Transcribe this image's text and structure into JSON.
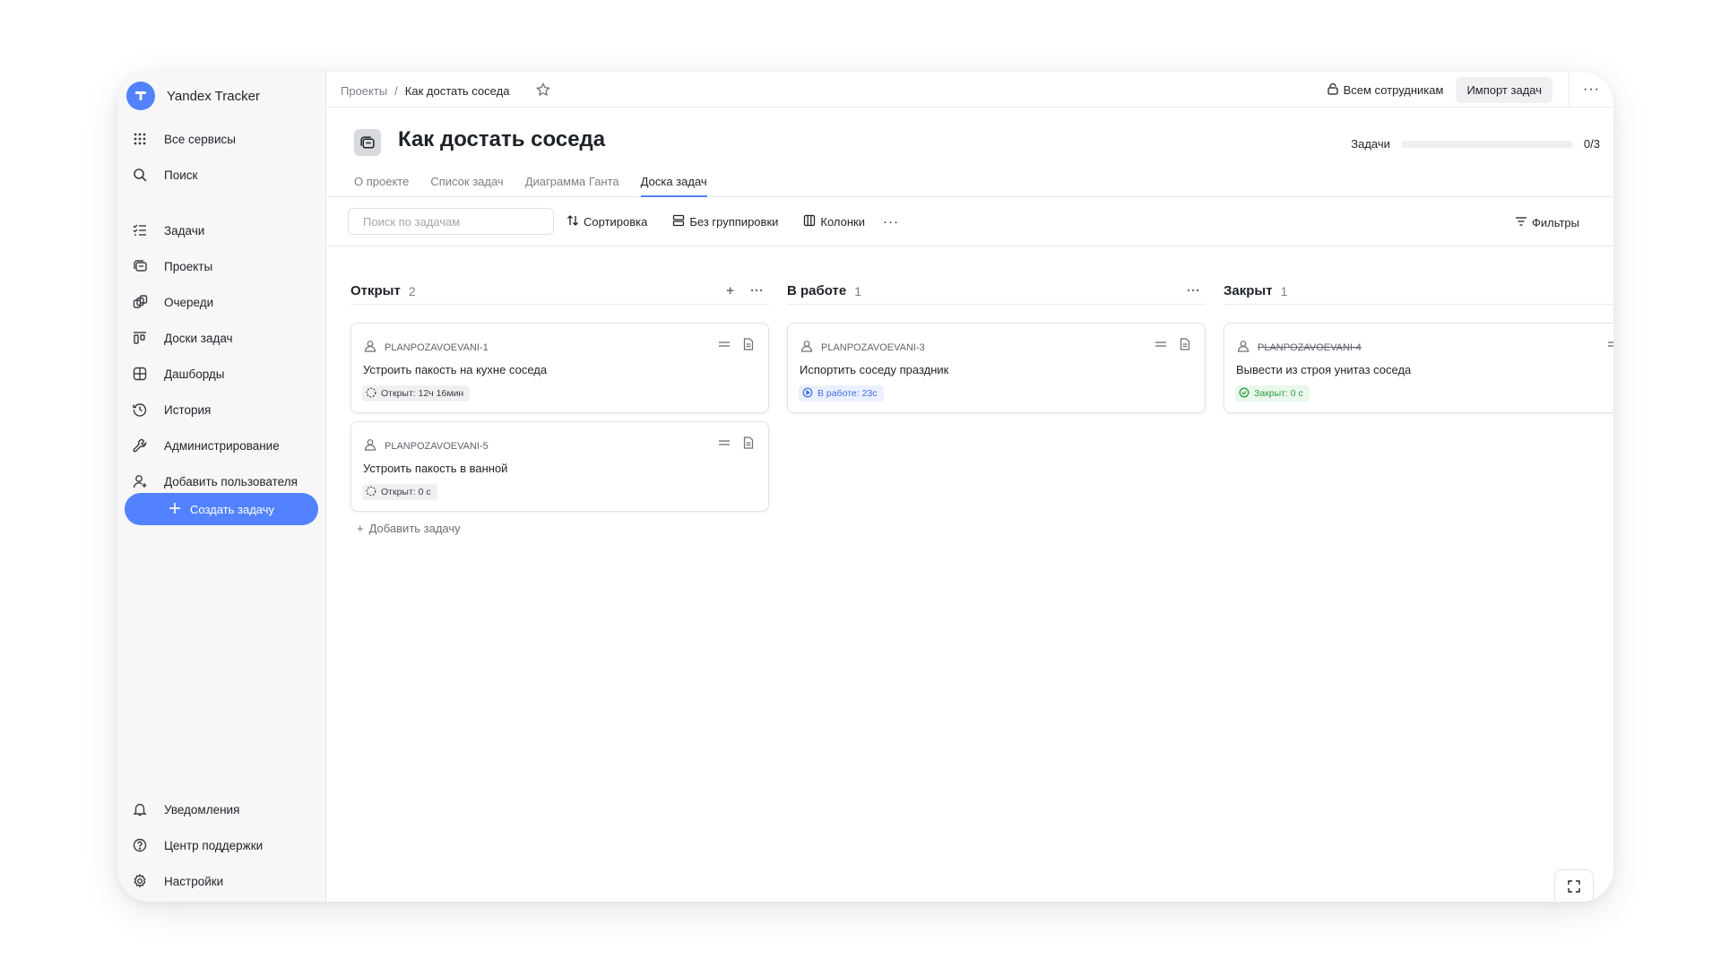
{
  "app": {
    "title": "Yandex Tracker"
  },
  "sidebar": {
    "top_items": [
      {
        "label": "Все сервисы",
        "icon": "grid-icon"
      },
      {
        "label": "Поиск",
        "icon": "search-icon"
      }
    ],
    "items": [
      {
        "label": "Задачи",
        "icon": "tasks-icon"
      },
      {
        "label": "Проекты",
        "icon": "projects-icon"
      },
      {
        "label": "Очереди",
        "icon": "queues-icon"
      },
      {
        "label": "Доски задач",
        "icon": "boards-icon"
      },
      {
        "label": "Дашборды",
        "icon": "dashboards-icon"
      },
      {
        "label": "История",
        "icon": "history-icon"
      },
      {
        "label": "Администрирование",
        "icon": "wrench-icon"
      },
      {
        "label": "Добавить пользователя",
        "icon": "add-user-icon"
      }
    ],
    "create_label": "Создать задачу",
    "bottom_items": [
      {
        "label": "Уведомления",
        "icon": "bell-icon"
      },
      {
        "label": "Центр поддержки",
        "icon": "help-icon"
      },
      {
        "label": "Настройки",
        "icon": "gear-icon"
      }
    ]
  },
  "breadcrumb": {
    "root": "Проекты",
    "separator": "/",
    "current": "Как достать соседа"
  },
  "topbar": {
    "access_label": "Всем сотрудникам",
    "import_label": "Импорт задач"
  },
  "project": {
    "title": "Как достать соседа",
    "progress_label": "Задачи",
    "progress_value": "0/3",
    "progress_fraction": 0
  },
  "tabs": [
    {
      "label": "О проекте",
      "active": false
    },
    {
      "label": "Список задач",
      "active": false
    },
    {
      "label": "Диаграмма Ганта",
      "active": false
    },
    {
      "label": "Доска задач",
      "active": true
    }
  ],
  "toolbar": {
    "search_placeholder": "Поиск по задачам",
    "sort_label": "Сортировка",
    "group_label": "Без группировки",
    "columns_label": "Колонки",
    "filters_label": "Фильтры"
  },
  "columns": [
    {
      "title": "Открыт",
      "count": "2"
    },
    {
      "title": "В работе",
      "count": "1"
    },
    {
      "title": "Закрыт",
      "count": "1"
    }
  ],
  "cards": [
    {
      "key": "PLANPOZAVOEVANI-1",
      "title": "Устроить пакость на кухне соседа",
      "status": "Открыт: 12ч 16мин"
    },
    {
      "key": "PLANPOZAVOEVANI-5",
      "title": "Устроить пакость в ванной",
      "status": "Открыт: 0 с"
    },
    {
      "key": "PLANPOZAVOEVANI-3",
      "title": "Испортить соседу праздник",
      "status": "В работе: 23с"
    },
    {
      "key": "PLANPOZAVOEVANI-4",
      "title": "Вывести из строя унитаз соседа",
      "status": "Закрыт: 0 с"
    }
  ],
  "add_task_label": "Добавить задачу",
  "colors": {
    "accent": "#5282ff",
    "in_progress": "#3f6fe8",
    "done": "#2e9e44"
  }
}
